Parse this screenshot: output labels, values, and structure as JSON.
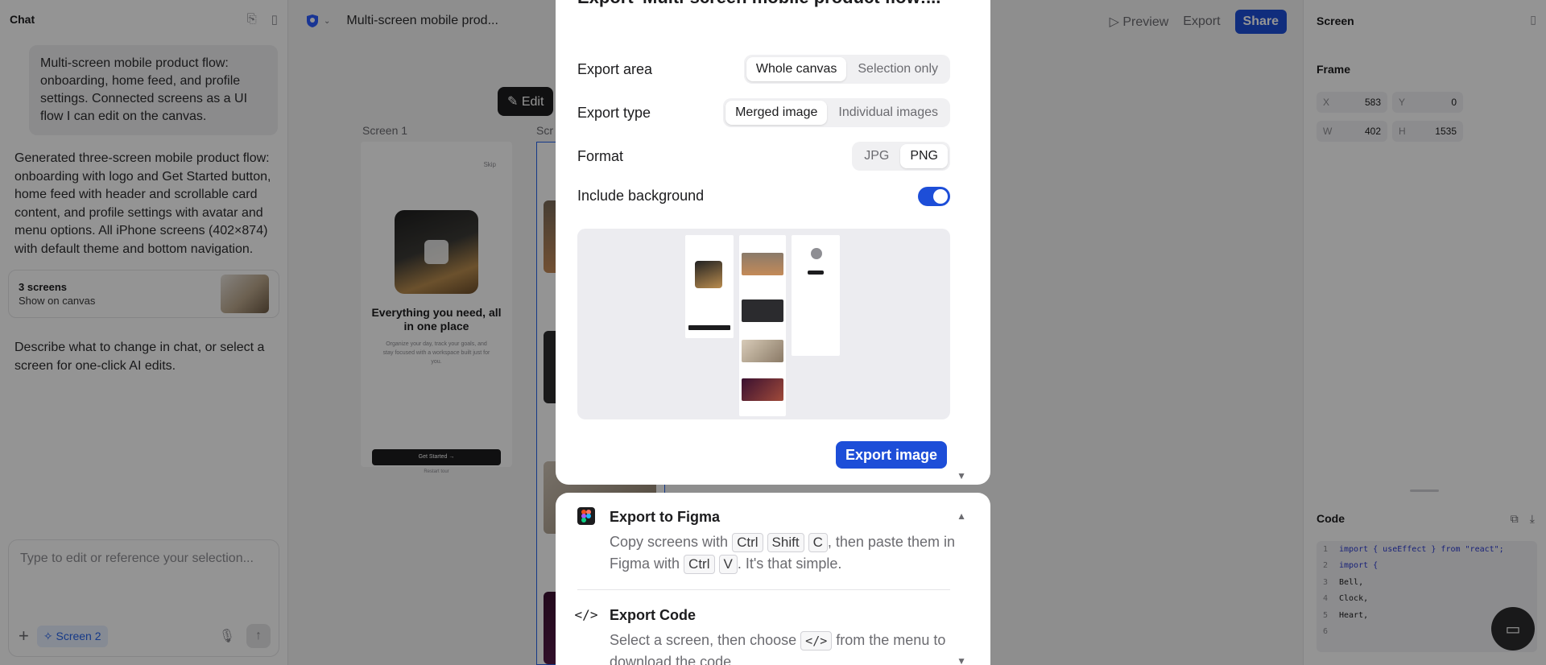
{
  "chat": {
    "title": "Chat",
    "user_message": "Multi-screen mobile product flow: onboarding, home feed, and profile settings. Connected screens as a UI flow I can edit on the canvas.",
    "ai_message": "Generated three-screen mobile product flow: onboarding with logo and Get Started button, home feed with header and scrollable card content, and profile settings with avatar and menu options. All iPhone screens (402×874) with default theme and bottom navigation.",
    "screens_card": {
      "title": "3 screens",
      "subtitle": "Show on canvas"
    },
    "hint": "Describe what to change in chat, or select a screen for one-click AI edits.",
    "input_placeholder": "Type to edit or reference your selection...",
    "screen_chip": "Screen 2"
  },
  "topbar": {
    "doc_title": "Multi-screen mobile prod...",
    "preview": "Preview",
    "export": "Export",
    "share": "Share"
  },
  "canvas": {
    "edit_pill": "Edit",
    "screen1_label": "Screen 1",
    "screen2_label_partial": "Scr",
    "phone1": {
      "skip": "Skip",
      "headline": "Everything you need, all in one place",
      "subtext": "Organize your day, track your goals, and stay focused with a workspace built just for you.",
      "cta": "Get Started →",
      "footer": "Restart tour"
    }
  },
  "right_panel": {
    "title": "Screen",
    "frame_label": "Frame",
    "fields": [
      {
        "key": "X",
        "value": "583"
      },
      {
        "key": "Y",
        "value": "0"
      },
      {
        "key": "W",
        "value": "402"
      },
      {
        "key": "H",
        "value": "1535"
      }
    ],
    "code_label": "Code",
    "code_lines": [
      {
        "n": "1",
        "text": "import { useEffect } from \"react\";"
      },
      {
        "n": "2",
        "text": "import {"
      },
      {
        "n": "3",
        "text": "  Bell,"
      },
      {
        "n": "4",
        "text": "  Clock,"
      },
      {
        "n": "5",
        "text": "  Heart,"
      },
      {
        "n": "6",
        "text": ""
      }
    ]
  },
  "modal": {
    "title": "Export 'Multi-screen mobile product flow:...'",
    "export_area": {
      "label": "Export area",
      "options": [
        "Whole canvas",
        "Selection only"
      ],
      "selected": "Whole canvas"
    },
    "export_type": {
      "label": "Export type",
      "options": [
        "Merged image",
        "Individual images"
      ],
      "selected": "Merged image"
    },
    "format": {
      "label": "Format",
      "options": [
        "JPG",
        "PNG"
      ],
      "selected": "PNG"
    },
    "include_background": {
      "label": "Include background",
      "on": true
    },
    "export_button": "Export image"
  },
  "figma_section": {
    "title": "Export to Figma",
    "text_before": "Copy screens with",
    "keys1": [
      "Ctrl",
      "Shift",
      "C"
    ],
    "text_mid": ", then paste them in Figma with",
    "keys2": [
      "Ctrl",
      "V"
    ],
    "text_after": ". It's that simple."
  },
  "code_section": {
    "title": "Export Code",
    "text_before": "Select a screen, then choose",
    "key": "</>",
    "text_after": "from the menu to download the code."
  },
  "colors": {
    "accent": "#1d4ed8",
    "overlay": "rgba(0,0,0,0.42)"
  }
}
